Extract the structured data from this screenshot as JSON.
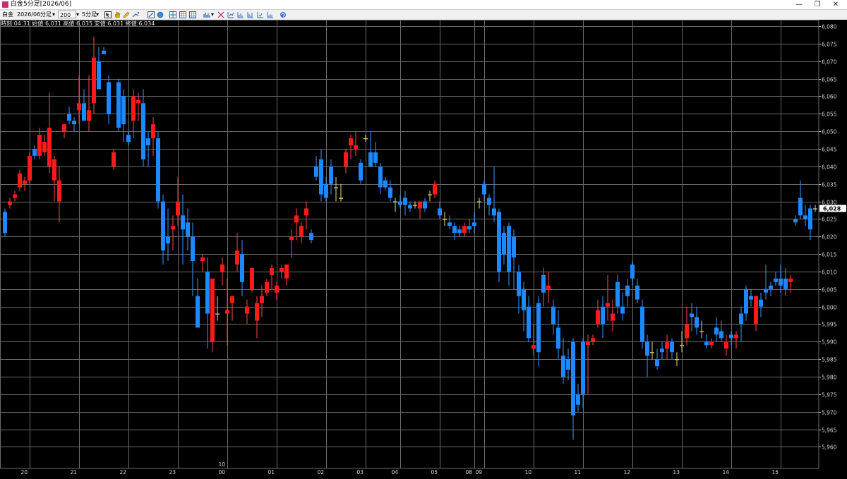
{
  "window": {
    "title": "白金5分足[2026/06]"
  },
  "toolbar": {
    "symbol": "白金",
    "contract": "2026/06",
    "timeframe_unit": "分足",
    "count": "200",
    "interval": "5分足",
    "icons": [
      "cursor-icon",
      "hand-icon",
      "pencil-icon",
      "trendline-icon",
      "line-icon",
      "zoom-icon",
      "grid-icon",
      "table-icon",
      "bar-chart-icon",
      "candle-settings-icon",
      "indicator-icon",
      "indicator-icon-2",
      "indicator-icon-3",
      "indicator-icon-4",
      "indicator-icon-5",
      "refresh-icon"
    ]
  },
  "info_line": "時刻:04:31 始値:6,031 高値:6,035 安値:6,031 終値:6,034",
  "colors": {
    "up": "#ff1a1a",
    "down": "#1e88ff",
    "doji": "#e8d87a",
    "wick": "#ff4a4a",
    "grid": "#6b6b6b",
    "background": "#000000",
    "price_tag": "#ffffff"
  },
  "chart_data": {
    "type": "candlestick",
    "title": "",
    "xlabel": "",
    "ylabel": "",
    "ylim": [
      5958,
      6082
    ],
    "y_ticks": [
      "6,080",
      "6,075",
      "6,070",
      "6,065",
      "6,060",
      "6,055",
      "6,050",
      "6,045",
      "6,040",
      "6,035",
      "6,030",
      "6,025",
      "6,020",
      "6,015",
      "6,010",
      "6,005",
      "6,000",
      "5,995",
      "5,990",
      "5,985",
      "5,980",
      "5,975",
      "5,970",
      "5,965",
      "5,960"
    ],
    "x_ticks": [
      {
        "i": 3,
        "label": "20"
      },
      {
        "i": 13,
        "label": "21"
      },
      {
        "i": 23,
        "label": "22"
      },
      {
        "i": 33,
        "label": "23"
      },
      {
        "i": 43,
        "label": "00",
        "sub": "10"
      },
      {
        "i": 53,
        "label": "01"
      },
      {
        "i": 63,
        "label": "02"
      },
      {
        "i": 71,
        "label": "03"
      },
      {
        "i": 78,
        "label": "04"
      },
      {
        "i": 86,
        "label": "05"
      },
      {
        "i": 93,
        "label": "08"
      },
      {
        "i": 95,
        "label": "09"
      },
      {
        "i": 105,
        "label": "10"
      },
      {
        "i": 115,
        "label": "11"
      },
      {
        "i": 125,
        "label": "12"
      },
      {
        "i": 135,
        "label": "13"
      },
      {
        "i": 145,
        "label": "14"
      },
      {
        "i": 155,
        "label": "15"
      }
    ],
    "last_price": "6,028",
    "last_value": 6028,
    "ohlc": [
      [
        6027,
        6028,
        6020,
        6021
      ],
      [
        6029,
        6031,
        6028,
        6030
      ],
      [
        6031,
        6033,
        6030,
        6032
      ],
      [
        6034,
        6039,
        6033,
        6038
      ],
      [
        6035,
        6037,
        6033,
        6036
      ],
      [
        6036,
        6044,
        6035,
        6043
      ],
      [
        6045,
        6046,
        6042,
        6043
      ],
      [
        6043,
        6051,
        6042,
        6049
      ],
      [
        6044,
        6049,
        6043,
        6047
      ],
      [
        6040,
        6061,
        6038,
        6051
      ],
      [
        6036,
        6043,
        6030,
        6042
      ],
      [
        6030,
        6040,
        6024,
        6036
      ],
      [
        6050,
        6052,
        6048,
        6052
      ],
      [
        6055,
        6057,
        6052,
        6053
      ],
      [
        6053,
        6054,
        6050,
        6052
      ],
      [
        6056,
        6066,
        6052,
        6058
      ],
      [
        6058,
        6062,
        6055,
        6053
      ],
      [
        6053,
        6066,
        6050,
        6056
      ],
      [
        6058,
        6077,
        6055,
        6071
      ],
      [
        6070,
        6074,
        6064,
        6062
      ],
      [
        6073,
        6074,
        6072,
        6072
      ],
      [
        6064,
        6066,
        6052,
        6055
      ],
      [
        6040,
        6045,
        6039,
        6044
      ],
      [
        6064,
        6065,
        6050,
        6051
      ],
      [
        6060,
        6062,
        6047,
        6052
      ],
      [
        6049,
        6050,
        6046,
        6047
      ],
      [
        6053,
        6062,
        6048,
        6060
      ],
      [
        6058,
        6061,
        6053,
        6059
      ],
      [
        6058,
        6062,
        6040,
        6042
      ],
      [
        6048,
        6050,
        6040,
        6046
      ],
      [
        6048,
        6054,
        6043,
        6052
      ],
      [
        6048,
        6050,
        6028,
        6030
      ],
      [
        6030,
        6032,
        6012,
        6016
      ],
      [
        6020,
        6028,
        6013,
        6018
      ],
      [
        6022,
        6026,
        6016,
        6023
      ],
      [
        6026,
        6037,
        6023,
        6030
      ],
      [
        6026,
        6032,
        6012,
        6022
      ],
      [
        6024,
        6028,
        6016,
        6020
      ],
      [
        6020,
        6024,
        6003,
        6013
      ],
      [
        6003,
        6008,
        5996,
        5994
      ],
      [
        6013,
        6015,
        6010,
        6014
      ],
      [
        6010,
        6014,
        5988,
        5998
      ],
      [
        5990,
        6001,
        5987,
        6008
      ],
      [
        5998,
        6003,
        5996,
        5998
      ],
      [
        6010,
        6014,
        6006,
        6012
      ],
      [
        5998,
        6008,
        5989,
        5999
      ],
      [
        6001,
        6003,
        5996,
        6003
      ],
      [
        6012,
        6021,
        6010,
        6016
      ],
      [
        6015,
        6019,
        6003,
        6007
      ],
      [
        5998,
        6002,
        5995,
        6000
      ],
      [
        6005,
        6011,
        6004,
        6011
      ],
      [
        5996,
        6003,
        5991,
        6001
      ],
      [
        6001,
        6006,
        5997,
        6003
      ],
      [
        6004,
        6008,
        6003,
        6007
      ],
      [
        6009,
        6012,
        6005,
        6011
      ],
      [
        6004,
        6007,
        6002,
        6006
      ],
      [
        6010,
        6012,
        6008,
        6011
      ],
      [
        6008,
        6012,
        6006,
        6012
      ],
      [
        6019,
        6022,
        6014,
        6020
      ],
      [
        6024,
        6028,
        6019,
        6026
      ],
      [
        6020,
        6024,
        6018,
        6023
      ],
      [
        6026,
        6030,
        6022,
        6028
      ],
      [
        6021,
        6022,
        6018,
        6019
      ],
      [
        6040,
        6043,
        6036,
        6037
      ],
      [
        6042,
        6045,
        6030,
        6032
      ],
      [
        6035,
        6037,
        6030,
        6031
      ],
      [
        6040,
        6042,
        6032,
        6035
      ],
      [
        6034,
        6037,
        6030,
        6034
      ],
      [
        6031,
        6035,
        6030,
        6031
      ],
      [
        6040,
        6045,
        6038,
        6044
      ],
      [
        6046,
        6049,
        6042,
        6048
      ],
      [
        6045,
        6050,
        6043,
        6046
      ],
      [
        6041,
        6042,
        6035,
        6036
      ],
      [
        6048,
        6049,
        6047,
        6048
      ],
      [
        6044,
        6050,
        6042,
        6040
      ],
      [
        6044,
        6047,
        6040,
        6041
      ],
      [
        6040,
        6041,
        6032,
        6034
      ],
      [
        6036,
        6037,
        6033,
        6034
      ],
      [
        6034,
        6036,
        6030,
        6031
      ],
      [
        6030,
        6031,
        6027,
        6030
      ],
      [
        6030,
        6032,
        6028,
        6029
      ],
      [
        6031,
        6033,
        6026,
        6029
      ],
      [
        6029,
        6030,
        6027,
        6028
      ],
      [
        6029,
        6030,
        6028,
        6029
      ],
      [
        6028,
        6030,
        6025,
        6030
      ],
      [
        6030,
        6031,
        6027,
        6028
      ],
      [
        6032,
        6033,
        6030,
        6032
      ],
      [
        6032,
        6036,
        6031,
        6035
      ],
      [
        6028,
        6030,
        6025,
        6026
      ],
      [
        6025,
        6027,
        6023,
        6025
      ],
      [
        6024,
        6026,
        6022,
        6023
      ],
      [
        6023,
        6024,
        6019,
        6021
      ],
      [
        6022,
        6023,
        6020,
        6021
      ],
      [
        6021,
        6024,
        6020,
        6023
      ],
      [
        6023,
        6025,
        6021,
        6022
      ],
      [
        6024,
        6027,
        6021,
        6023
      ],
      [
        6030,
        6031,
        6028,
        6030
      ],
      [
        6035,
        6036,
        6030,
        6032
      ],
      [
        6031,
        6032,
        6026,
        6029
      ],
      [
        6028,
        6040,
        6024,
        6026
      ],
      [
        6027,
        6028,
        6007,
        6010
      ],
      [
        6021,
        6023,
        6012,
        6015
      ],
      [
        6023,
        6024,
        6006,
        6010
      ],
      [
        6020,
        6022,
        6005,
        6014
      ],
      [
        6010,
        6012,
        5998,
        6003
      ],
      [
        6005,
        6007,
        5993,
        5999
      ],
      [
        6000,
        6003,
        5990,
        5991
      ],
      [
        5988,
        5995,
        5986,
        5989
      ],
      [
        6001,
        6003,
        5983,
        5987
      ],
      [
        6009,
        6011,
        6000,
        6004
      ],
      [
        6005,
        6010,
        6001,
        6006
      ],
      [
        6000,
        6002,
        5992,
        5995
      ],
      [
        5994,
        5999,
        5985,
        5988
      ],
      [
        5986,
        5991,
        5978,
        5980
      ],
      [
        5985,
        5988,
        5979,
        5982
      ],
      [
        5990,
        5991,
        5962,
        5969
      ],
      [
        5975,
        5978,
        5970,
        5972
      ],
      [
        5990,
        5991,
        5971,
        5975
      ],
      [
        5989,
        5992,
        5975,
        5990
      ],
      [
        5990,
        5992,
        5989,
        5991
      ],
      [
        5995,
        6002,
        5994,
        5999
      ],
      [
        6000,
        6003,
        5991,
        5995
      ],
      [
        6000,
        6009,
        5996,
        6001
      ],
      [
        5996,
        6002,
        5993,
        5998
      ],
      [
        6007,
        6009,
        5998,
        6000
      ],
      [
        6000,
        6004,
        5996,
        5998
      ],
      [
        6006,
        6008,
        6000,
        6003
      ],
      [
        6012,
        6013,
        6006,
        6008
      ],
      [
        6006,
        6008,
        6001,
        6002
      ],
      [
        6000,
        6002,
        5988,
        5990
      ],
      [
        5990,
        5992,
        5980,
        5986
      ],
      [
        5987,
        5990,
        5985,
        5987
      ],
      [
        5985,
        5988,
        5982,
        5983
      ],
      [
        5988,
        5990,
        5985,
        5987
      ],
      [
        5988,
        5992,
        5985,
        5990
      ],
      [
        5990,
        5991,
        5985,
        5987
      ],
      [
        5985,
        5987,
        5983,
        5985
      ],
      [
        5989,
        5993,
        5987,
        5989
      ],
      [
        5991,
        6000,
        5989,
        5995
      ],
      [
        5998,
        6001,
        5993,
        5997
      ],
      [
        5997,
        6000,
        5992,
        5994
      ],
      [
        5993,
        5996,
        5991,
        5993
      ],
      [
        5990,
        5992,
        5988,
        5989
      ],
      [
        5989,
        5991,
        5988,
        5990
      ],
      [
        5994,
        5997,
        5990,
        5992
      ],
      [
        5993,
        5996,
        5990,
        5991
      ],
      [
        5988,
        5992,
        5986,
        5990
      ],
      [
        5992,
        5993,
        5989,
        5991
      ],
      [
        5991,
        5993,
        5988,
        5992
      ],
      [
        5998,
        6000,
        5990,
        5995
      ],
      [
        6005,
        6006,
        5996,
        5998
      ],
      [
        6003,
        6005,
        6000,
        6002
      ],
      [
        5995,
        6003,
        5993,
        6003
      ],
      [
        6002,
        6004,
        5997,
        6000
      ],
      [
        6005,
        6012,
        6002,
        6004
      ],
      [
        6006,
        6007,
        6003,
        6005
      ],
      [
        6008,
        6010,
        6006,
        6007
      ],
      [
        6008,
        6012,
        6004,
        6006
      ],
      [
        6008,
        6011,
        6003,
        6005
      ],
      [
        6007,
        6009,
        6004,
        6008
      ],
      [
        6025,
        6026,
        6023,
        6024
      ],
      [
        6031,
        6036,
        6025,
        6026
      ],
      [
        6026,
        6029,
        6023,
        6025
      ],
      [
        6028,
        6029,
        6019,
        6022
      ],
      [
        6028,
        6029,
        6027,
        6028
      ]
    ]
  }
}
